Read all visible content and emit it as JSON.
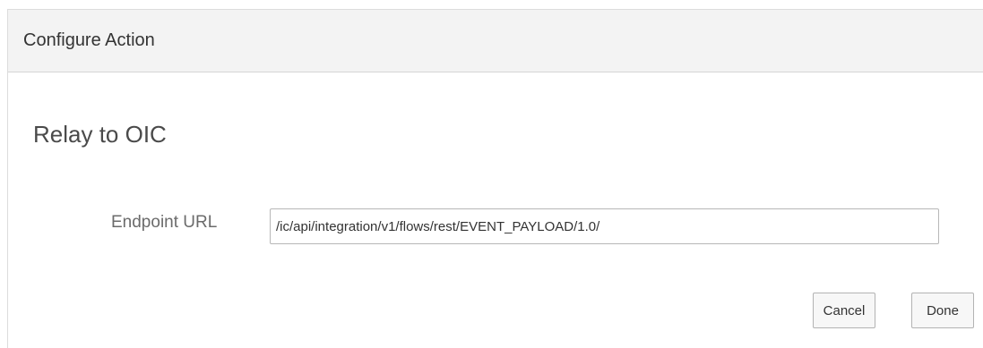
{
  "dialog": {
    "title": "Configure Action"
  },
  "section": {
    "title": "Relay to OIC"
  },
  "endpoint": {
    "label": "Endpoint URL",
    "value": "/ic/api/integration/v1/flows/rest/EVENT_PAYLOAD/1.0/"
  },
  "actions": {
    "cancel_label": "Cancel",
    "done_label": "Done"
  }
}
